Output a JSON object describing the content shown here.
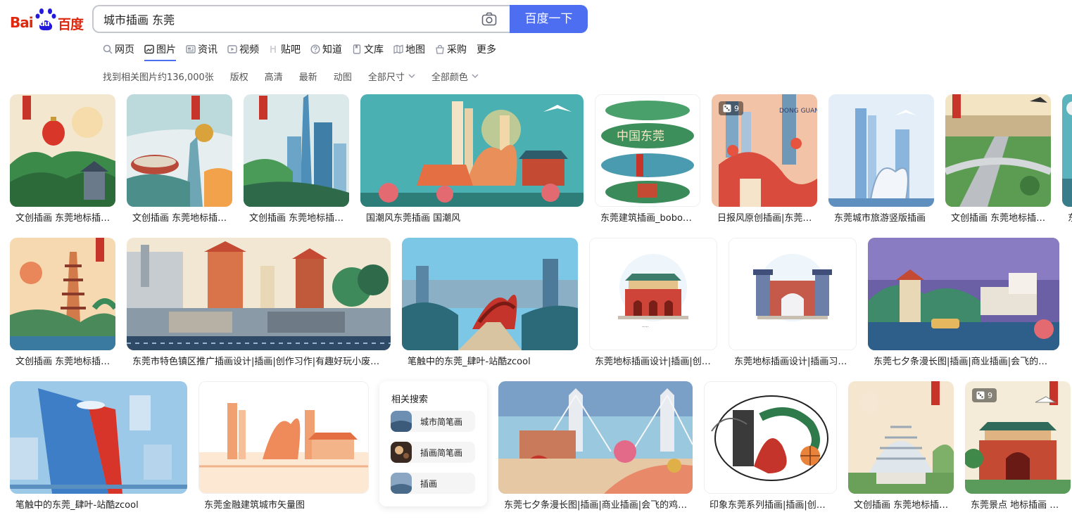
{
  "logo": {
    "bai": "Bai",
    "du": "du",
    "baidu_cn": "百度"
  },
  "search": {
    "query": "城市插画 东莞",
    "button_label": "百度一下"
  },
  "tabs": [
    {
      "label": "网页",
      "icon": "search-icon"
    },
    {
      "label": "图片",
      "icon": "image-icon",
      "active": true
    },
    {
      "label": "资讯",
      "icon": "news-icon"
    },
    {
      "label": "视频",
      "icon": "video-icon"
    },
    {
      "label": "贴吧",
      "icon": "tieba-icon"
    },
    {
      "label": "知道",
      "icon": "question-icon"
    },
    {
      "label": "文库",
      "icon": "doc-icon"
    },
    {
      "label": "地图",
      "icon": "map-icon"
    },
    {
      "label": "采购",
      "icon": "shop-icon"
    },
    {
      "label": "更多",
      "icon": ""
    }
  ],
  "filters": {
    "result_count": "找到相关图片约136,000张",
    "copyright": "版权",
    "hd": "高清",
    "latest": "最新",
    "animated": "动图",
    "size": "全部尺寸",
    "color": "全部颜色"
  },
  "results": [
    {
      "caption": "文创插画 东莞地标插画…"
    },
    {
      "caption": "文创插画 东莞地标插画…"
    },
    {
      "caption": "文创插画 东莞地标插画…"
    },
    {
      "caption": "国潮风东莞插画 国潮风"
    },
    {
      "caption": "东莞建筑插画_bobo…"
    },
    {
      "caption": "日报风原创插画|东莞…",
      "badge": "9"
    },
    {
      "caption": "东莞城市旅游竖版插画"
    },
    {
      "caption": "文创插画 东莞地标插画…"
    },
    {
      "caption": "东"
    },
    {
      "caption": "文创插画 东莞地标插画…"
    },
    {
      "caption": "东莞市特色镇区推广插画设计|插画|创作习作|有趣好玩小废…"
    },
    {
      "caption": "笔触中的东莞_肆叶-站酷zcool"
    },
    {
      "caption": "东莞地标插画设计|插画|创…"
    },
    {
      "caption": "东莞地标插画设计|插画习…"
    },
    {
      "caption": "东莞七夕条漫长图|插画|商业插画|会飞的…"
    },
    {
      "caption": "笔触中的东莞_肆叶-站酷zcool"
    },
    {
      "caption": "东莞金融建筑城市矢量图"
    },
    {
      "caption": "东莞七夕条漫长图|插画|商业插画|会飞的鸡…"
    },
    {
      "caption": "印象东莞系列插画|插画|创…"
    },
    {
      "caption": "文创插画 东莞地标插画…"
    },
    {
      "caption": "东莞景点 地标插画 …",
      "badge": "9"
    }
  ],
  "related": {
    "title": "相关搜索",
    "items": [
      "城市简笔画",
      "插画简笔画",
      "插画"
    ]
  },
  "colors": {
    "accent": "#4e6ef2",
    "brand_red": "#de2910",
    "brand_blue": "#2319dc"
  }
}
